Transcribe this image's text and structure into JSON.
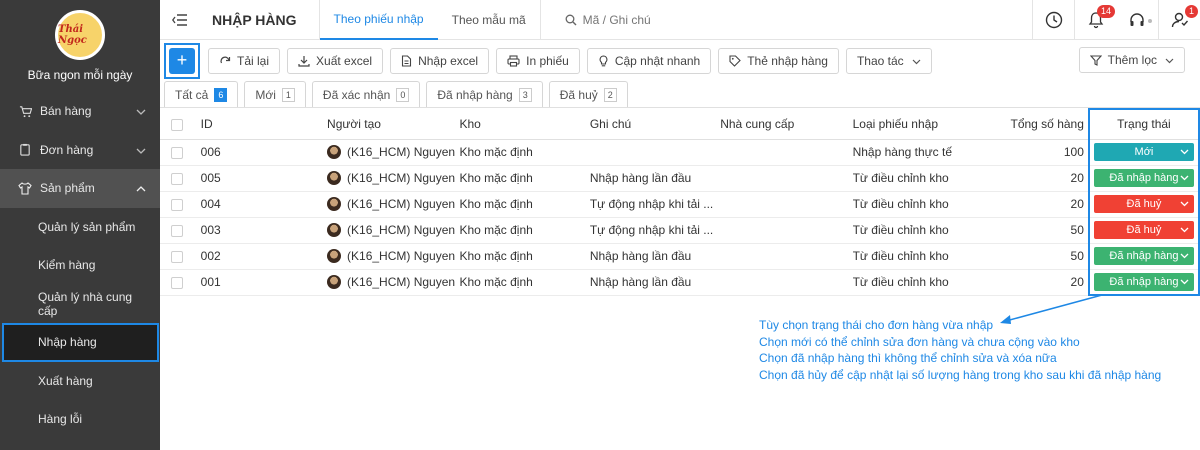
{
  "brand": {
    "logo_text": "Thái Ngọc",
    "name": "Bữa ngon mỗi ngày"
  },
  "sidebar": {
    "items": [
      {
        "label": "Bán hàng",
        "icon": "cart-icon",
        "has_chevron": true
      },
      {
        "label": "Đơn hàng",
        "icon": "clipboard-icon",
        "has_chevron": true
      },
      {
        "label": "Sản phẩm",
        "icon": "shirt-icon",
        "has_chevron": true,
        "open": true
      }
    ],
    "sub_items": [
      {
        "label": "Quản lý sản phẩm"
      },
      {
        "label": "Kiểm hàng"
      },
      {
        "label": "Quản lý nhà cung cấp"
      },
      {
        "label": "Nhập hàng",
        "active": true
      },
      {
        "label": "Xuất hàng"
      },
      {
        "label": "Hàng lỗi"
      }
    ]
  },
  "header": {
    "title": "NHẬP HÀNG",
    "tabs": [
      "Theo phiếu nhập",
      "Theo mẫu mã"
    ],
    "search_placeholder": "Mã / Ghi chú",
    "notification_count": "14",
    "user_badge": "1"
  },
  "toolbar": {
    "add_label": "+",
    "buttons": [
      "Tải lại",
      "Xuất excel",
      "Nhập excel",
      "In phiếu",
      "Cập nhật nhanh",
      "Thẻ nhập hàng",
      "Thao tác"
    ],
    "filter_label": "Thêm lọc"
  },
  "status_tabs": [
    {
      "label": "Tất cả",
      "count": "6"
    },
    {
      "label": "Mới",
      "count": "1"
    },
    {
      "label": "Đã xác nhận",
      "count": "0"
    },
    {
      "label": "Đã nhập hàng",
      "count": "3"
    },
    {
      "label": "Đã huỷ",
      "count": "2"
    }
  ],
  "table": {
    "columns": [
      "ID",
      "Người tạo",
      "Kho",
      "Ghi chú",
      "Nhà cung cấp",
      "Loại phiếu nhập",
      "Tổng số hàng",
      "Trạng thái"
    ],
    "rows": [
      {
        "id": "006",
        "creator": "(K16_HCM) Nguyen",
        "warehouse": "Kho mặc định",
        "note": "",
        "supplier": "",
        "type": "Nhập hàng thực tế",
        "total": "100",
        "status": "Mới",
        "status_color": "#1fa8b3"
      },
      {
        "id": "005",
        "creator": "(K16_HCM) Nguyen",
        "warehouse": "Kho mặc định",
        "note": "Nhập hàng lần đầu",
        "supplier": "",
        "type": "Từ điều chỉnh kho",
        "total": "20",
        "status": "Đã nhập hàng",
        "status_color": "#3cb371"
      },
      {
        "id": "004",
        "creator": "(K16_HCM) Nguyen",
        "warehouse": "Kho mặc định",
        "note": "Tự động nhập khi tải ...",
        "supplier": "",
        "type": "Từ điều chỉnh kho",
        "total": "20",
        "status": "Đã huỷ",
        "status_color": "#f04134"
      },
      {
        "id": "003",
        "creator": "(K16_HCM) Nguyen",
        "warehouse": "Kho mặc định",
        "note": "Tự động nhập khi tải ...",
        "supplier": "",
        "type": "Từ điều chỉnh kho",
        "total": "50",
        "status": "Đã huỷ",
        "status_color": "#f04134"
      },
      {
        "id": "002",
        "creator": "(K16_HCM) Nguyen",
        "warehouse": "Kho mặc định",
        "note": "Nhập hàng lần đầu",
        "supplier": "",
        "type": "Từ điều chỉnh kho",
        "total": "50",
        "status": "Đã nhập hàng",
        "status_color": "#3cb371"
      },
      {
        "id": "001",
        "creator": "(K16_HCM) Nguyen",
        "warehouse": "Kho mặc định",
        "note": "Nhập hàng lần đầu",
        "supplier": "",
        "type": "Từ điều chỉnh kho",
        "total": "20",
        "status": "Đã nhập hàng",
        "status_color": "#3cb371"
      }
    ]
  },
  "annotation": {
    "lines": [
      "Tùy chọn trạng thái cho đơn hàng vừa nhập",
      "Chọn mới có thể chỉnh sửa đơn hàng và chưa cộng vào kho",
      "Chọn đã nhập hàng thì không thể chỉnh sửa và xóa nữa",
      "Chọn đã hủy để cập nhật lại số lượng hàng trong kho sau khi đã nhập hàng"
    ]
  },
  "colors": {
    "accent": "#1e88e5",
    "sidebar_bg": "#3a3a3a",
    "new": "#1fa8b3",
    "imported": "#3cb371",
    "cancelled": "#f04134"
  }
}
